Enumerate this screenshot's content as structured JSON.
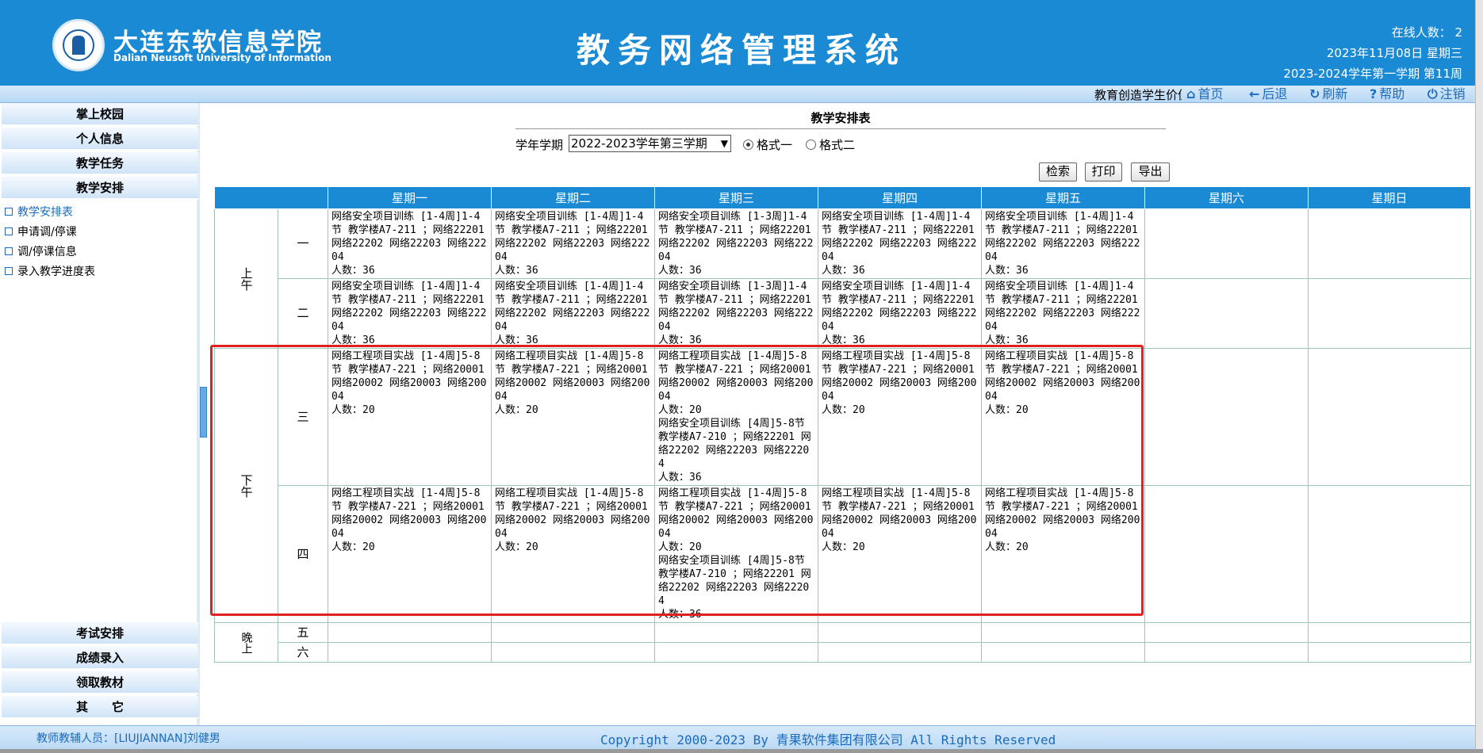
{
  "header": {
    "school_cn": "大连东软信息学院",
    "school_en": "Dalian Neusoft University of Information",
    "system_title": "教务网络管理系统",
    "online": "在线人数： 2",
    "date": "2023年11月08日 星期三",
    "term": "2023-2024学年第一学期 第11周"
  },
  "navbar": {
    "motto": "教育创造学生价值",
    "links": [
      {
        "icon": "home-icon",
        "label": "首页"
      },
      {
        "icon": "back-icon",
        "label": "后退"
      },
      {
        "icon": "refresh-icon",
        "label": "刷新"
      },
      {
        "icon": "help-icon",
        "label": "帮助"
      },
      {
        "icon": "logout-icon",
        "label": "注销"
      }
    ]
  },
  "sidebar": {
    "top_buttons": [
      "掌上校园",
      "个人信息",
      "教学任务",
      "教学安排"
    ],
    "sub_items": [
      "教学安排表",
      "申请调/停课",
      "调/停课信息",
      "录入教学进度表"
    ],
    "bottom_buttons": [
      "考试安排",
      "成绩录入",
      "领取教材",
      "其　　它"
    ]
  },
  "main": {
    "table_title": "教学安排表",
    "term_label": "学年学期",
    "term_selected": "2022-2023学年第三学期",
    "format_options": [
      "格式一",
      "格式二"
    ],
    "format_selected": 0,
    "buttons": [
      "检索",
      "打印",
      "导出"
    ],
    "days": [
      "星期一",
      "星期二",
      "星期三",
      "星期四",
      "星期五",
      "星期六",
      "星期日"
    ],
    "halves": [
      "上午",
      "下午",
      "晚上"
    ],
    "periods": [
      "一",
      "二",
      "三",
      "四",
      "五",
      "六"
    ],
    "cells": {
      "p1": [
        "网络安全项目训练 [1-4周]1-4节 教学楼A7-211 ；网络22201 网络22202 网络22203 网络22204\n人数：36",
        "网络安全项目训练 [1-4周]1-4节 教学楼A7-211 ；网络22201 网络22202 网络22203 网络22204\n人数：36",
        "网络安全项目训练 [1-3周]1-4节 教学楼A7-211 ；网络22201 网络22202 网络22203 网络22204\n人数：36",
        "网络安全项目训练 [1-4周]1-4节 教学楼A7-211 ；网络22201 网络22202 网络22203 网络22204\n人数：36",
        "网络安全项目训练 [1-4周]1-4节 教学楼A7-211 ；网络22201 网络22202 网络22203 网络22204\n人数：36",
        "",
        ""
      ],
      "p2": [
        "网络安全项目训练 [1-4周]1-4节 教学楼A7-211 ；网络22201 网络22202 网络22203 网络22204\n人数：36",
        "网络安全项目训练 [1-4周]1-4节 教学楼A7-211 ；网络22201 网络22202 网络22203 网络22204\n人数：36",
        "网络安全项目训练 [1-3周]1-4节 教学楼A7-211 ；网络22201 网络22202 网络22203 网络22204\n人数：36",
        "网络安全项目训练 [1-4周]1-4节 教学楼A7-211 ；网络22201 网络22202 网络22203 网络22204\n人数：36",
        "网络安全项目训练 [1-4周]1-4节 教学楼A7-211 ；网络22201 网络22202 网络22203 网络22204\n人数：36",
        "",
        ""
      ],
      "p3": [
        "网络工程项目实战 [1-4周]5-8节 教学楼A7-221 ；网络20001 网络20002 网络20003 网络20004\n人数：20",
        "网络工程项目实战 [1-4周]5-8节 教学楼A7-221 ；网络20001 网络20002 网络20003 网络20004\n人数：20",
        "网络工程项目实战 [1-4周]5-8节 教学楼A7-221 ；网络20001 网络20002 网络20003 网络20004\n人数：20\n网络安全项目训练 [4周]5-8节 教学楼A7-210 ；网络22201 网络22202 网络22203 网络22204\n人数：36",
        "网络工程项目实战 [1-4周]5-8节 教学楼A7-221 ；网络20001 网络20002 网络20003 网络20004\n人数：20",
        "网络工程项目实战 [1-4周]5-8节 教学楼A7-221 ；网络20001 网络20002 网络20003 网络20004\n人数：20",
        "",
        ""
      ],
      "p4": [
        "网络工程项目实战 [1-4周]5-8节 教学楼A7-221 ；网络20001 网络20002 网络20003 网络20004\n人数：20",
        "网络工程项目实战 [1-4周]5-8节 教学楼A7-221 ；网络20001 网络20002 网络20003 网络20004\n人数：20",
        "网络工程项目实战 [1-4周]5-8节 教学楼A7-221 ；网络20001 网络20002 网络20003 网络20004\n人数：20\n网络安全项目训练 [4周]5-8节 教学楼A7-210 ；网络22201 网络22202 网络22203 网络22204\n人数：36",
        "网络工程项目实战 [1-4周]5-8节 教学楼A7-221 ；网络20001 网络20002 网络20003 网络20004\n人数：20",
        "网络工程项目实战 [1-4周]5-8节 教学楼A7-221 ；网络20001 网络20002 网络20003 网络20004\n人数：20",
        "",
        ""
      ]
    }
  },
  "footer": {
    "teacher": "教师教辅人员：[LIUJIANNAN]刘健男",
    "copyright_pre": "Copyright 2000-2023 By",
    "copyright_org": "青果软件集团有限公司",
    "copyright_post": "All Rights Reserved"
  },
  "colors": {
    "header_bg": "#1a8ad4",
    "link_blue": "#1a6bbd",
    "highlight_red": "#e02020"
  }
}
